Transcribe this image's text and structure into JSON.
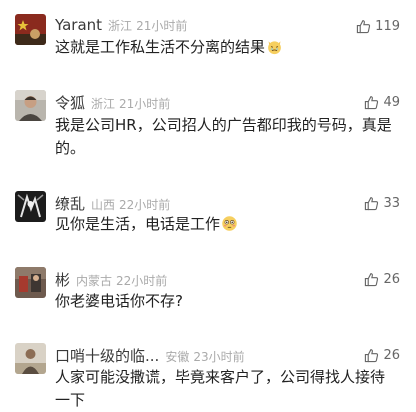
{
  "comments": [
    {
      "username": "Yarant",
      "location": "浙江",
      "time": "21小时前",
      "likes": "119",
      "text": "这就是工作私生活不分离的结果",
      "emoji": "crying-cat-emoji",
      "avatar": "flag-avatar"
    },
    {
      "username": "令狐",
      "location": "浙江",
      "time": "21小时前",
      "likes": "49",
      "text": "我是公司HR，公司招人的广告都印我的号码，真是的。",
      "avatar": "portrait-avatar"
    },
    {
      "username": "缭乱",
      "location": "山西",
      "time": "22小时前",
      "likes": "33",
      "text": "见你是生活，电话是工作",
      "emoji": "flushed-face-emoji",
      "avatar": "dark-art-avatar"
    },
    {
      "username": "彬",
      "location": "内蒙古",
      "time": "22小时前",
      "likes": "26",
      "text": "你老婆电话你不存?",
      "avatar": "scene-avatar"
    },
    {
      "username": "口哨十级的临...",
      "location": "安徽",
      "time": "23小时前",
      "likes": "26",
      "text": "人家可能没撒谎，毕竟来客户了，公司得找人接待一下",
      "avatar": "person-avatar"
    }
  ],
  "colors": {
    "username": "#3a3a3a",
    "meta": "#aaaaaa",
    "text": "#222222",
    "like": "#666666"
  },
  "icons": {
    "like": "thumbs-up-icon"
  }
}
